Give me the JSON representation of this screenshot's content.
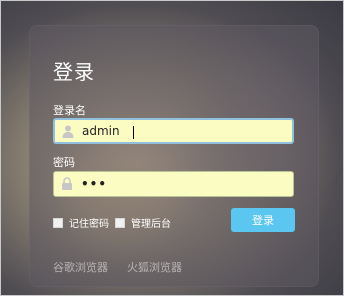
{
  "login": {
    "title": "登录",
    "username_label": "登录名",
    "username_value": "admin",
    "password_label": "密码",
    "password_value": "•••",
    "remember_label": "记住密码",
    "admin_label": "管理后台",
    "login_button": "登录",
    "browser_links": [
      "谷歌浏览器",
      "火狐浏览器"
    ]
  },
  "colors": {
    "input_background": "#fbfcc2",
    "button_accent": "#5bc7f0",
    "focus_border": "#8fc1de"
  },
  "icons": {
    "username": "user-icon",
    "password": "lock-icon"
  }
}
